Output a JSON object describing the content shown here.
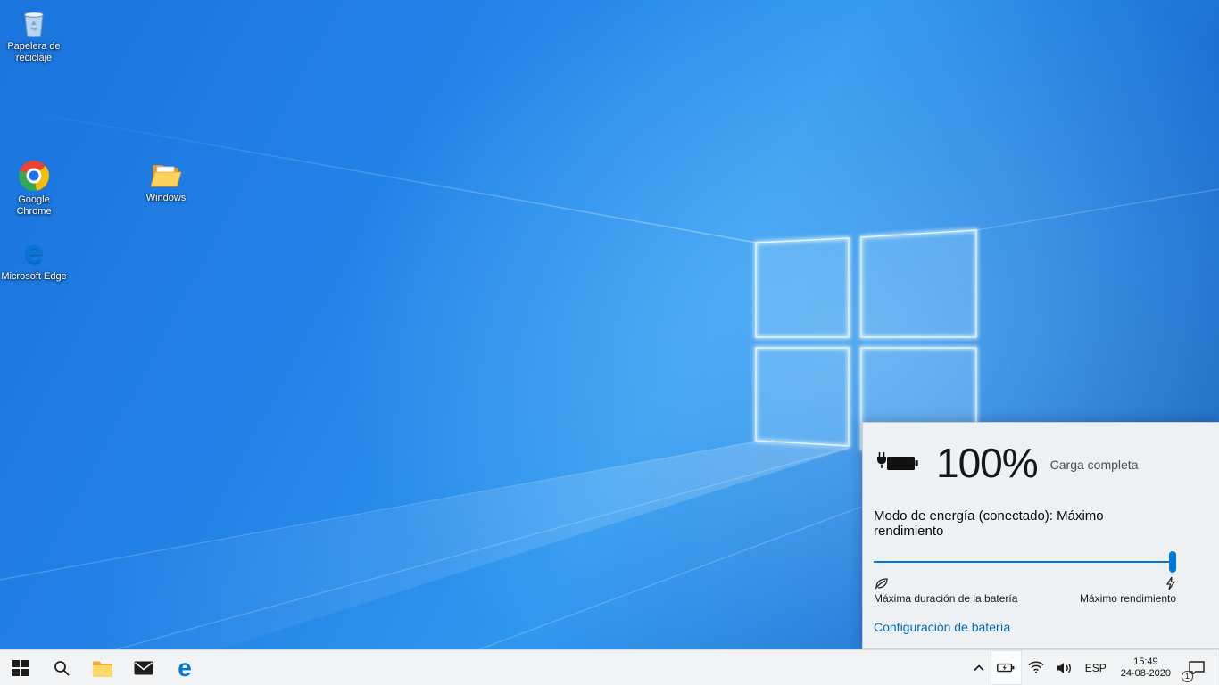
{
  "desktop": {
    "icons": [
      {
        "label": "Papelera de reciclaje"
      },
      {
        "label": "Google Chrome"
      },
      {
        "label": "Windows"
      },
      {
        "label": "Microsoft Edge",
        "glyph": "e"
      }
    ]
  },
  "battery_flyout": {
    "percent": "100%",
    "status": "Carga completa",
    "mode_label": "Modo de energía (conectado): Máximo rendimiento",
    "left_label": "Máxima duración de la batería",
    "right_label": "Máximo rendimiento",
    "settings_link": "Configuración de batería",
    "accent_color": "#0078d7"
  },
  "taskbar": {
    "edge_glyph": "e",
    "tray": {
      "language": "ESP",
      "time": "15:49",
      "date": "24-08-2020",
      "notification_badge": "1"
    }
  }
}
